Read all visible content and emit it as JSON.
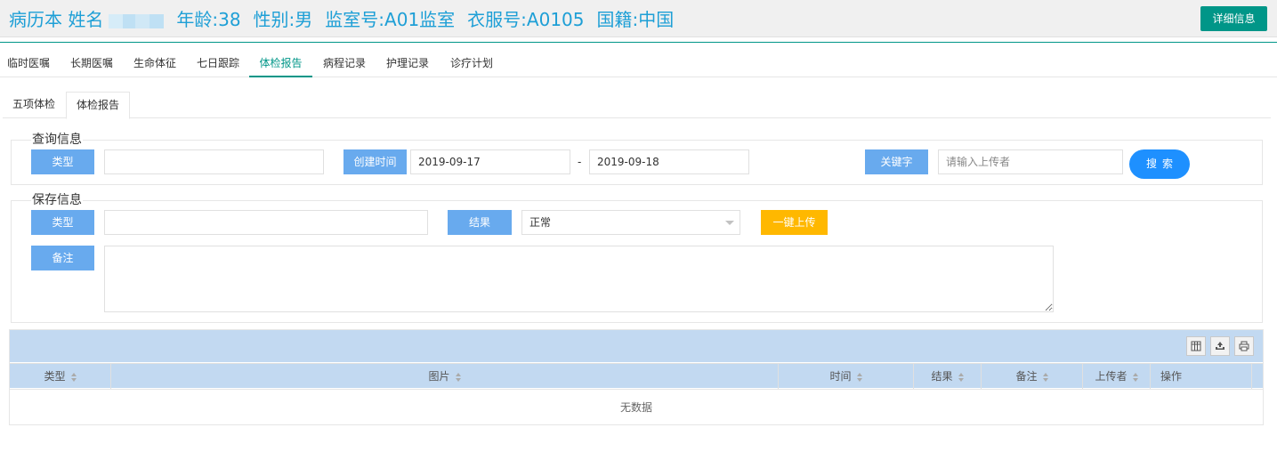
{
  "header": {
    "case_label": "病历本 姓名",
    "age": "年龄:38",
    "gender": "性别:男",
    "cell": "监室号:A01监室",
    "clothing": "衣服号:A0105",
    "nationality": "国籍:中国",
    "detail_button": "详细信息"
  },
  "main_tabs": [
    "临时医嘱",
    "长期医嘱",
    "生命体征",
    "七日跟踪",
    "体检报告",
    "病程记录",
    "护理记录",
    "诊疗计划"
  ],
  "sub_tabs": [
    "五项体检",
    "体检报告"
  ],
  "query": {
    "legend": "查询信息",
    "type_label": "类型",
    "type_value": "",
    "created_label": "创建时间",
    "date_from": "2019-09-17",
    "date_sep": "-",
    "date_to": "2019-09-18",
    "keyword_label": "关键字",
    "keyword_placeholder": "请输入上传者",
    "search_button": "搜索"
  },
  "save": {
    "legend": "保存信息",
    "type_label": "类型",
    "type_value": "",
    "result_label": "结果",
    "result_value": "正常",
    "upload_button": "一键上传",
    "remark_label": "备注",
    "remark_value": ""
  },
  "table": {
    "columns": [
      "类型",
      "图片",
      "时间",
      "结果",
      "备注",
      "上传者",
      "操作"
    ],
    "empty_text": "无数据",
    "toolbar_icons": [
      "columns-icon",
      "export-icon",
      "print-icon"
    ]
  },
  "colors": {
    "primary_teal": "#009688",
    "label_blue": "#68aaee",
    "search_blue": "#1e90ff",
    "upload_yellow": "#ffb800",
    "table_header": "#c2d9f1",
    "title_text": "#1e9fd6"
  }
}
